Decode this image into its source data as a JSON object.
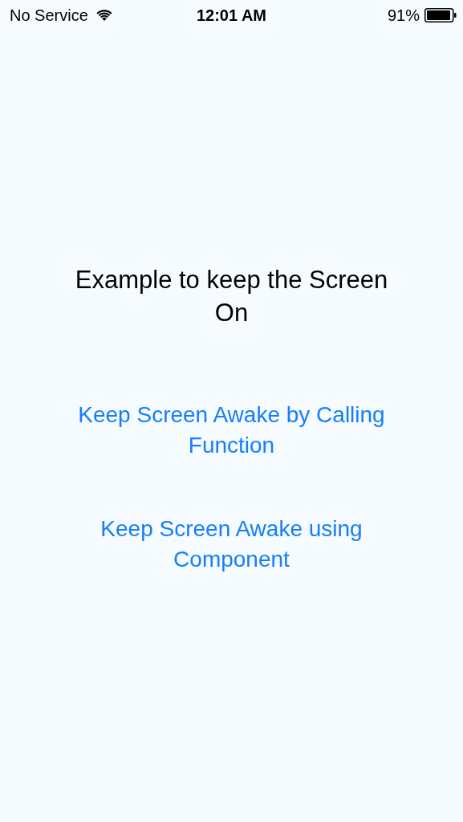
{
  "status_bar": {
    "carrier": "No Service",
    "time": "12:01 AM",
    "battery": "91%"
  },
  "title": "Example to keep the Screen On",
  "buttons": [
    {
      "label": "Keep Screen Awake by Calling Function"
    },
    {
      "label": "Keep Screen Awake using Component"
    }
  ]
}
